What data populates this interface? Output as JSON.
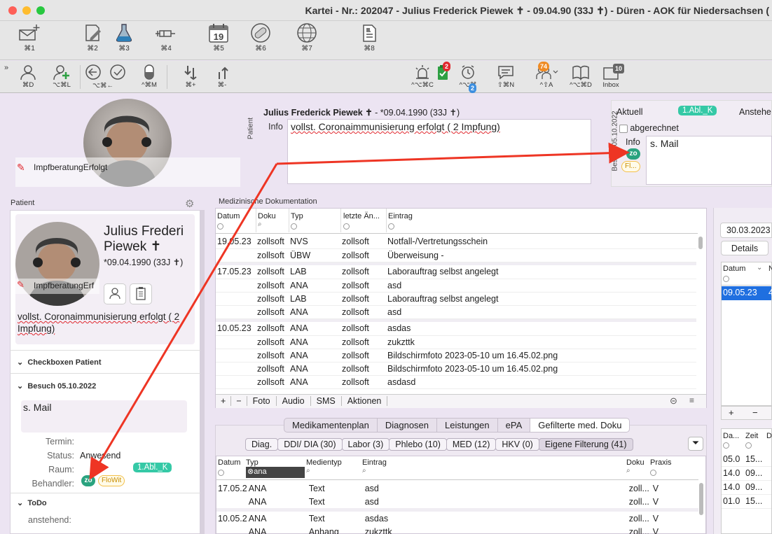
{
  "window": {
    "title": "Kartei - Nr.: 202047 - Julius Frederick Piewek ✝ - 09.04.90 (33J ✝) - Düren - AOK für Niedersachsen (",
    "colors": {
      "close": "#fe5f57",
      "minimize": "#febc2e",
      "zoom": "#28c840"
    }
  },
  "toolbar_main": {
    "items": [
      {
        "icon": "mail-add-icon",
        "shortcut": "⌘1"
      },
      {
        "icon": "document-edit-icon",
        "shortcut": "⌘2"
      },
      {
        "icon": "flask-icon",
        "shortcut": "⌘3"
      },
      {
        "icon": "syringe-icon",
        "shortcut": "⌘4"
      },
      {
        "icon": "calendar-icon",
        "shortcut": "⌘5",
        "day": "19"
      },
      {
        "icon": "pill-icon",
        "shortcut": "⌘6"
      },
      {
        "icon": "globe-icon",
        "shortcut": "⌘7"
      },
      {
        "icon": "document-icon",
        "shortcut": "⌘8"
      }
    ]
  },
  "toolbar_secondary": {
    "items": [
      {
        "icon": "person-icon",
        "shortcut": "⌘D"
      },
      {
        "icon": "person-add-icon",
        "shortcut": "⌥⌘L"
      },
      {
        "icon": "back-arrow-icon",
        "shortcut": "⌥⌘←"
      },
      {
        "icon": "checkmark-icon",
        "shortcut": ""
      },
      {
        "icon": "pill-half-icon",
        "shortcut": "^⌘M"
      },
      {
        "icon": "sort-down-icon",
        "shortcut": "⌘+"
      },
      {
        "icon": "sort-up-icon",
        "shortcut": "⌘-"
      },
      {
        "icon": "alarm-light-icon",
        "shortcut": "^⌥⌘C"
      },
      {
        "icon": "clipboard-icon",
        "shortcut": "",
        "badge": "2"
      },
      {
        "icon": "alarm-clock-icon",
        "shortcut": "^⌥⌘",
        "badge": "2"
      },
      {
        "icon": "message-icon",
        "shortcut": "⇧⌘N"
      },
      {
        "icon": "people-icon",
        "shortcut": "^⇧A",
        "badge": "74"
      },
      {
        "icon": "book-icon",
        "shortcut": "^⌥⌘D"
      },
      {
        "icon": "inbox-icon",
        "shortcut": "Inbox",
        "badge": "10"
      }
    ]
  },
  "photo_top": {
    "caption": "ImpfberatungErfolgt"
  },
  "patient_header": {
    "vertical_label": "Patient",
    "name": "Julius Frederick Piewek ✝",
    "dob": "- *09.04.1990 (33J ✝)",
    "info_label": "Info",
    "info_text": "vollst. Coronaimmunisierung erfolgt ( 2  Impfung)"
  },
  "visit_box": {
    "vertical_label": "Besuch 05.10.2022",
    "aktuell_label": "Aktuell",
    "room_pill": "1.Abl._K",
    "anstehend": "Anstehe",
    "abgerechnet": "abgerechnet",
    "info_label": "Info",
    "info_text": "s. Mail",
    "zo": "zo",
    "flo": "Fl..."
  },
  "sidebar": {
    "title": "Patient",
    "name_line1": "Julius Frederi",
    "name_line2": "Piewek ✝",
    "dob": "*09.04.1990 (33J  ✝)",
    "photo_caption": "ImpfberatungErf",
    "info_text": "vollst. Coronaimmunisierung erfolgt ( 2  Impfung)",
    "sec_checkboxen": "Checkboxen Patient",
    "sec_besuch": "Besuch 05.10.2022",
    "besuch_note": "s. Mail",
    "termin_label": "Termin:",
    "status_label": "Status:",
    "status_value": "Anwesend",
    "raum_label": "Raum:",
    "raum_value": "1.Abl._K",
    "behandler_label": "Behandler:",
    "zo": "zo",
    "flo": "FloWit",
    "sec_todo": "ToDo",
    "anstehend_label": "anstehend:"
  },
  "med_doc": {
    "title": "Medizinische Dokumentation",
    "columns": [
      "Datum",
      "Doku",
      "Typ",
      "letzte Än...",
      "Eintrag"
    ],
    "rows": [
      {
        "date": "19.05.23",
        "doku": "zollsoft",
        "typ": "NVS",
        "last": "zollsoft",
        "entry": "Notfall-/Vertretungsschein"
      },
      {
        "date": "",
        "doku": "zollsoft",
        "typ": "ÜBW",
        "last": "zollsoft",
        "entry": "Überweisung -"
      },
      {
        "sep": true
      },
      {
        "date": "17.05.23",
        "doku": "zollsoft",
        "typ": "LAB",
        "last": "zollsoft",
        "entry": "Laborauftrag selbst angelegt"
      },
      {
        "date": "",
        "doku": "zollsoft",
        "typ": "ANA",
        "last": "zollsoft",
        "entry": "asd"
      },
      {
        "date": "",
        "doku": "zollsoft",
        "typ": "LAB",
        "last": "zollsoft",
        "entry": "Laborauftrag selbst angelegt"
      },
      {
        "date": "",
        "doku": "zollsoft",
        "typ": "ANA",
        "last": "zollsoft",
        "entry": "asd"
      },
      {
        "sep": true
      },
      {
        "date": "10.05.23",
        "doku": "zollsoft",
        "typ": "ANA",
        "last": "zollsoft",
        "entry": "asdas"
      },
      {
        "date": "",
        "doku": "zollsoft",
        "typ": "ANA",
        "last": "zollsoft",
        "entry": "zukzttk"
      },
      {
        "date": "",
        "doku": "zollsoft",
        "typ": "ANA",
        "last": "zollsoft",
        "entry": "Bildschirmfoto 2023-05-10 um 16.45.02.png"
      },
      {
        "date": "",
        "doku": "zollsoft",
        "typ": "ANA",
        "last": "zollsoft",
        "entry": "Bildschirmfoto 2023-05-10 um 16.45.02.png"
      },
      {
        "date": "",
        "doku": "zollsoft",
        "typ": "ANA",
        "last": "zollsoft",
        "entry": "asdasd"
      }
    ],
    "bottom_buttons": [
      "+",
      "−",
      "Foto",
      "Audio",
      "SMS",
      "Aktionen"
    ]
  },
  "lower_tabs": [
    "Medikamentenplan",
    "Diagnosen",
    "Leistungen",
    "ePA",
    "Gefilterte med. Doku"
  ],
  "filter_chips": [
    "Diag.",
    "DDI/ DIA (30)",
    "Labor (3)",
    "Phlebo (10)",
    "MED (12)",
    "HKV (0)",
    "Eigene Filterung (41)"
  ],
  "lower_table": {
    "columns": [
      "Datum",
      "Typ",
      "Medientyp",
      "Eintrag",
      "Doku",
      "Praxis"
    ],
    "typ_filter": "ana",
    "rows": [
      {
        "date": "17.05.2",
        "typ": "ANA",
        "medium": "Text",
        "entry": "asd",
        "doku": "zoll...",
        "praxis": "V"
      },
      {
        "date": "",
        "typ": "ANA",
        "medium": "Text",
        "entry": "asd",
        "doku": "zoll...",
        "praxis": "V"
      },
      {
        "sep": true
      },
      {
        "date": "10.05.2",
        "typ": "ANA",
        "medium": "Text",
        "entry": "asdas",
        "doku": "zoll...",
        "praxis": "V"
      },
      {
        "date": "",
        "typ": "ANA",
        "medium": "Anhang",
        "entry": "zukzttk",
        "doku": "zoll...",
        "praxis": "V"
      }
    ]
  },
  "right_panel": {
    "date_field": "30.03.2023",
    "details_button": "Details",
    "col_datum": "Datum",
    "col_n": "N",
    "selected_date": "09.05.23",
    "selected_val": "4",
    "lower_cols": [
      "Da...",
      "Zeit",
      "D"
    ],
    "lower_rows": [
      [
        "05.0",
        "15..."
      ],
      [
        "14.0",
        "09..."
      ],
      [
        "14.0",
        "09..."
      ],
      [
        "01.0",
        "15..."
      ]
    ]
  },
  "annotation": {
    "arrow_color": "#ee3524"
  }
}
